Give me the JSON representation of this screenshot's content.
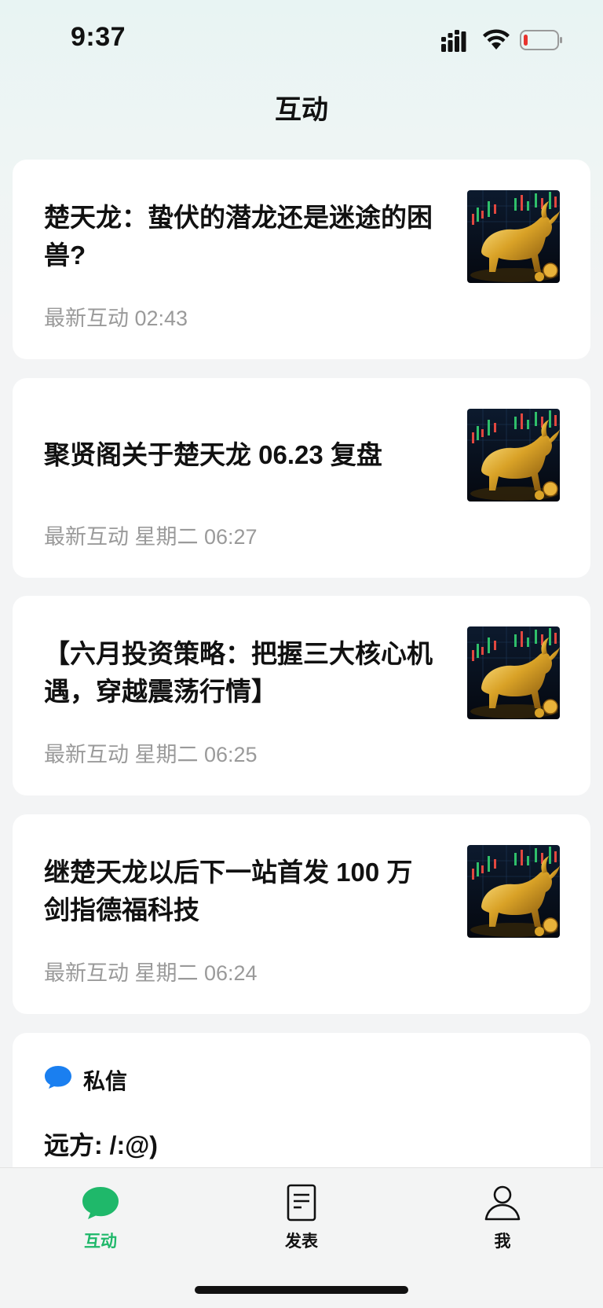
{
  "status_bar": {
    "time": "9:37"
  },
  "header": {
    "title": "互动"
  },
  "cards": [
    {
      "title": "楚天龙：蛰伏的潜龙还是迷途的困兽?",
      "meta": "最新互动 02:43",
      "thumb_icon": "golden-bull-image"
    },
    {
      "title": "聚贤阁关于楚天龙 06.23 复盘",
      "meta": "最新互动 星期二 06:27",
      "thumb_icon": "golden-bull-image"
    },
    {
      "title": "【六月投资策略：把握三大核心机遇，穿越震荡行情】",
      "meta": "最新互动 星期二 06:25",
      "thumb_icon": "golden-bull-image"
    },
    {
      "title": "继楚天龙以后下一站首发 100 万剑指德福科技",
      "meta": "最新互动 星期二 06:24",
      "thumb_icon": "golden-bull-image"
    }
  ],
  "direct_messages": {
    "label": "私信",
    "latest": "远方: /:@)",
    "icon": "chat-bubble-icon",
    "icon_color": "#1a7ff0"
  },
  "tabbar": {
    "tabs": [
      {
        "label": "互动",
        "icon": "chat-bubble-icon",
        "active": true
      },
      {
        "label": "发表",
        "icon": "document-icon",
        "active": false
      },
      {
        "label": "我",
        "icon": "person-icon",
        "active": false
      }
    ],
    "active_color": "#1fb86a"
  }
}
